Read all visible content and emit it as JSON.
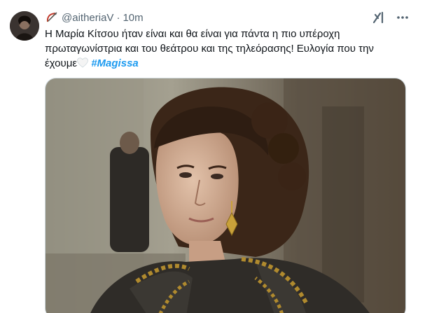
{
  "tweet": {
    "handle": "@aitheriaV",
    "separator": "·",
    "time": "10m",
    "text": "Η Μαρία Κίτσου ήταν είναι και θα είναι για πάντα η πιο υπέροχη πρωταγωνίστρια και του θεάτρου και της τηλεόρασης! Ευλογία που την έχουμε",
    "hashtag": "#Magissa"
  },
  "colors": {
    "accent": "#1d9bf0",
    "text": "#0f1419",
    "muted": "#536471"
  },
  "icons": [
    "avatar",
    "bow-arrow-emoji",
    "grok-icon",
    "more-icon",
    "white-heart-emoji"
  ]
}
